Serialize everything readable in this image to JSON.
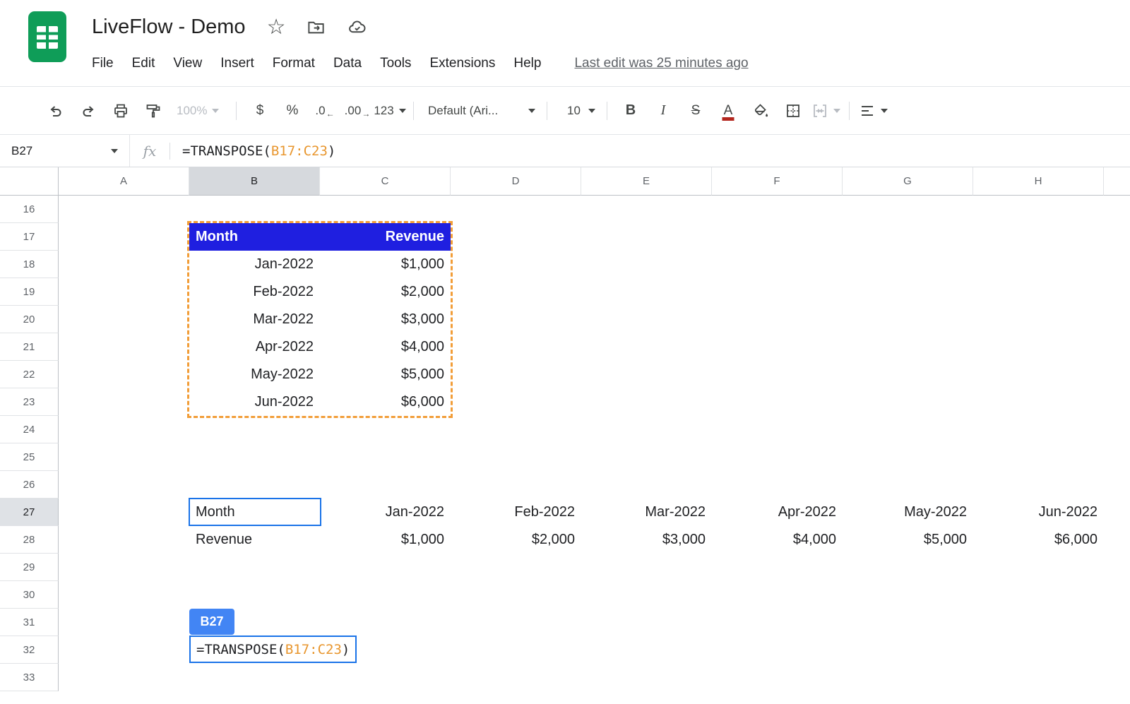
{
  "app": {
    "title": "LiveFlow - Demo",
    "menus": [
      "File",
      "Edit",
      "View",
      "Insert",
      "Format",
      "Data",
      "Tools",
      "Extensions",
      "Help"
    ],
    "last_edit": "Last edit was 25 minutes ago"
  },
  "toolbar": {
    "zoom": "100%",
    "currency": "$",
    "percent": "%",
    "decrease_decimals": ".0",
    "increase_decimals": ".00",
    "more_formats": "123",
    "font": "Default (Ari...",
    "font_size": "10",
    "bold": "B",
    "italic": "I",
    "strikethrough": "S",
    "text_color": "A"
  },
  "formula_bar": {
    "cell_ref": "B27",
    "fx_label": "fx",
    "formula_prefix": "=TRANSPOSE(",
    "formula_range": "B17:C23",
    "formula_suffix": ")"
  },
  "grid": {
    "column_headers": [
      "A",
      "B",
      "C",
      "D",
      "E",
      "F",
      "G",
      "H"
    ],
    "row_start": 16,
    "row_end": 33,
    "highlighted_column": "B",
    "highlighted_row": 27,
    "cells": {
      "B17": {
        "t": "Month",
        "s": "hl"
      },
      "C17": {
        "t": "Revenue",
        "s": "hr"
      },
      "B18": {
        "t": "Jan-2022",
        "s": "r"
      },
      "C18": {
        "t": "$1,000",
        "s": "r"
      },
      "B19": {
        "t": "Feb-2022",
        "s": "r"
      },
      "C19": {
        "t": "$2,000",
        "s": "r"
      },
      "B20": {
        "t": "Mar-2022",
        "s": "r"
      },
      "C20": {
        "t": "$3,000",
        "s": "r"
      },
      "B21": {
        "t": "Apr-2022",
        "s": "r"
      },
      "C21": {
        "t": "$4,000",
        "s": "r"
      },
      "B22": {
        "t": "May-2022",
        "s": "r"
      },
      "C22": {
        "t": "$5,000",
        "s": "r"
      },
      "B23": {
        "t": "Jun-2022",
        "s": "r"
      },
      "C23": {
        "t": "$6,000",
        "s": "r"
      },
      "B27": {
        "t": "Month",
        "s": "l"
      },
      "C27": {
        "t": "Jan-2022",
        "s": "r"
      },
      "D27": {
        "t": "Feb-2022",
        "s": "r"
      },
      "E27": {
        "t": "Mar-2022",
        "s": "r"
      },
      "F27": {
        "t": "Apr-2022",
        "s": "r"
      },
      "G27": {
        "t": "May-2022",
        "s": "r"
      },
      "H27": {
        "t": "Jun-2022",
        "s": "r"
      },
      "B28": {
        "t": "Revenue",
        "s": "l"
      },
      "C28": {
        "t": "$1,000",
        "s": "r"
      },
      "D28": {
        "t": "$2,000",
        "s": "r"
      },
      "E28": {
        "t": "$3,000",
        "s": "r"
      },
      "F28": {
        "t": "$4,000",
        "s": "r"
      },
      "G28": {
        "t": "$5,000",
        "s": "r"
      },
      "H28": {
        "t": "$6,000",
        "s": "r"
      }
    }
  },
  "overlays": {
    "copy_range": "B17:C23",
    "active_cell": "B27",
    "badge_label": "B27",
    "formula_prefix": "=TRANSPOSE(",
    "formula_range": "B17:C23",
    "formula_suffix": ")"
  },
  "colors": {
    "table_header_bg": "#1f1fe0",
    "copy_range_dash": "#f29d38",
    "selection_blue": "#1a73e8",
    "badge_blue": "#4285f4",
    "formula_range_orange": "#e8962e",
    "sheets_green": "#0f9d58"
  }
}
